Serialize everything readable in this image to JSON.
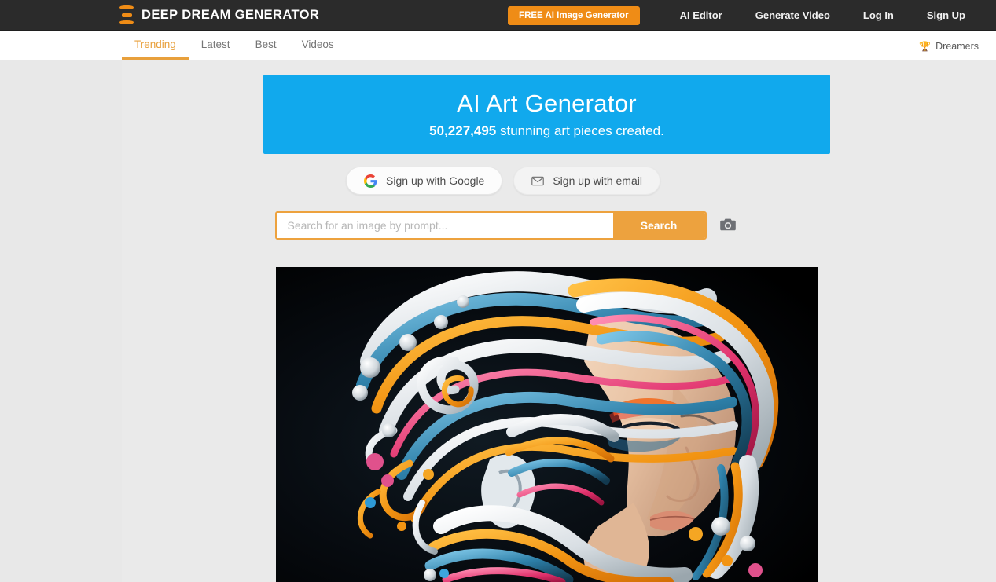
{
  "header": {
    "brand": "DEEP DREAM GENERATOR",
    "logo_icon": "hourglass-stack-icon",
    "cta_label": "FREE AI Image Generator",
    "nav": [
      {
        "label": "AI Editor"
      },
      {
        "label": "Generate Video"
      },
      {
        "label": "Log In"
      },
      {
        "label": "Sign Up"
      }
    ],
    "colors": {
      "bar": "#2b2b2b",
      "accent": "#ef8c16"
    }
  },
  "subnav": {
    "tabs": [
      {
        "label": "Trending",
        "active": true
      },
      {
        "label": "Latest",
        "active": false
      },
      {
        "label": "Best",
        "active": false
      },
      {
        "label": "Videos",
        "active": false
      }
    ],
    "dreamers": {
      "label": "Dreamers",
      "icon": "trophy-icon"
    },
    "active_color": "#e8a03c"
  },
  "hero": {
    "title": "AI Art Generator",
    "count": "50,227,495",
    "subtitle_rest": " stunning art pieces created.",
    "bg_color": "#11a9ed"
  },
  "signup": {
    "google": {
      "label": "Sign up with Google",
      "icon": "google-g-icon"
    },
    "email": {
      "label": "Sign up with email",
      "icon": "envelope-icon"
    }
  },
  "search": {
    "placeholder": "Search for an image by prompt...",
    "value": "",
    "button_label": "Search",
    "camera_icon": "camera-icon",
    "accent": "#eda23e"
  },
  "gallery": {
    "featured": {
      "alt": "Surreal portrait of a woman with swirling multicolored flowing hair",
      "background": "#050608"
    }
  }
}
